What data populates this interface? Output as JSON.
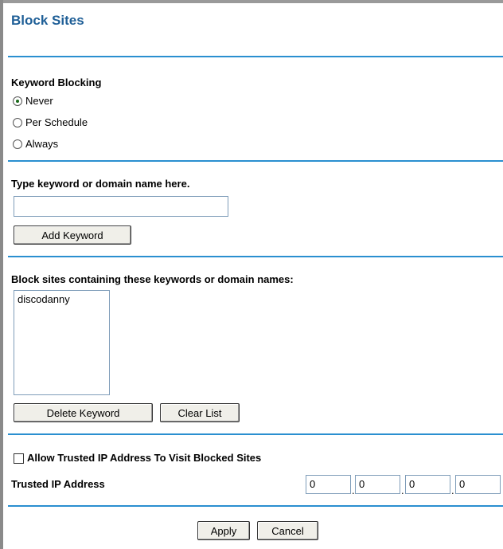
{
  "page": {
    "title": "Block Sites"
  },
  "keyword_blocking": {
    "heading": "Keyword Blocking",
    "options": [
      {
        "label": "Never",
        "checked": true
      },
      {
        "label": "Per Schedule",
        "checked": false
      },
      {
        "label": "Always",
        "checked": false
      }
    ]
  },
  "add_keyword": {
    "prompt": "Type keyword or domain name here.",
    "input_value": "",
    "button_label": "Add Keyword"
  },
  "block_list": {
    "heading": "Block sites containing these keywords or domain names:",
    "items": [
      "discodanny"
    ],
    "delete_label": "Delete Keyword",
    "clear_label": "Clear List"
  },
  "trusted": {
    "checkbox_label": "Allow Trusted IP Address To Visit Blocked Sites",
    "checked": false,
    "ip_label": "Trusted IP Address",
    "ip": [
      "0",
      "0",
      "0",
      "0"
    ]
  },
  "actions": {
    "apply_label": "Apply",
    "cancel_label": "Cancel"
  },
  "colors": {
    "title": "#1f5f97",
    "rule": "#2a8fd0"
  }
}
